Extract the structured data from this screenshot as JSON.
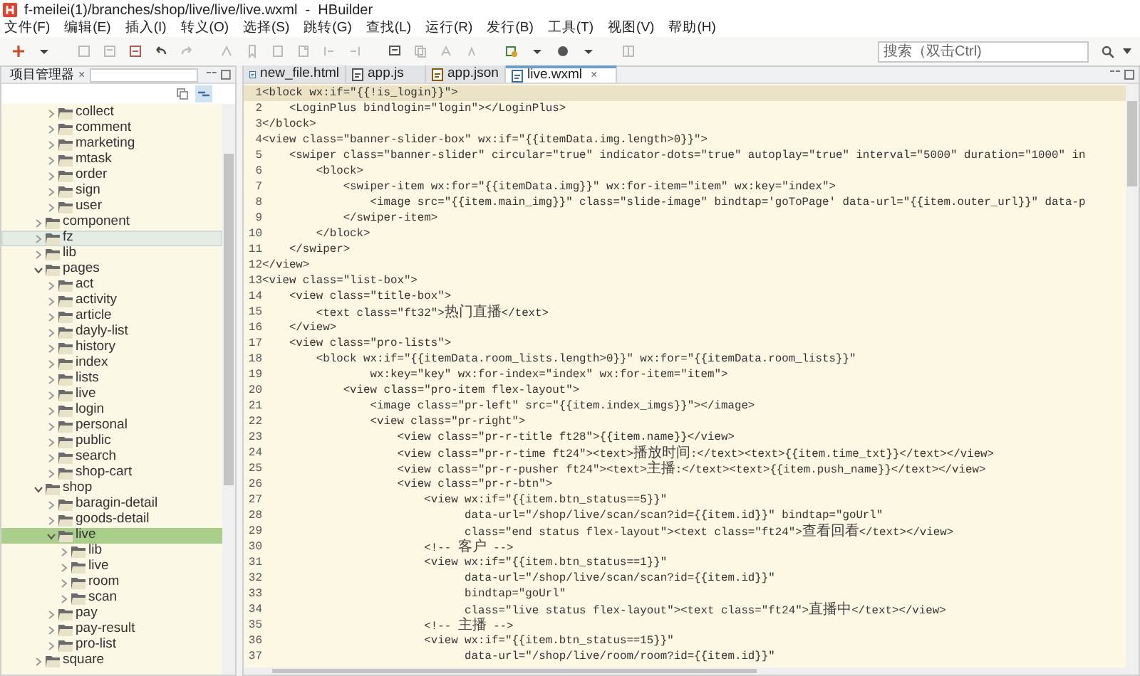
{
  "window": {
    "title": "f-meilei(1)/branches/shop/live/live/live.wxml  -  HBuilder"
  },
  "menu": [
    "文件(F)",
    "编辑(E)",
    "插入(I)",
    "转义(O)",
    "选择(S)",
    "跳转(G)",
    "查找(L)",
    "运行(R)",
    "发行(B)",
    "工具(T)",
    "视图(V)",
    "帮助(H)"
  ],
  "search": {
    "placeholder": "搜索（双击Ctrl)"
  },
  "project_panel": {
    "title": "项目管理器",
    "close": "×",
    "tree": [
      {
        "children": [
          {
            "label": "collect",
            "expanded": false,
            "selected": false,
            "hovered": false
          },
          {
            "label": "comment",
            "expanded": false,
            "selected": false,
            "hovered": false
          },
          {
            "label": "marketing",
            "expanded": false,
            "selected": false,
            "hovered": false
          },
          {
            "label": "mtask",
            "expanded": false,
            "selected": false,
            "hovered": false
          },
          {
            "label": "order",
            "expanded": false,
            "selected": false,
            "hovered": false
          },
          {
            "label": "sign",
            "expanded": false,
            "selected": false,
            "hovered": false
          },
          {
            "label": "user",
            "expanded": false,
            "selected": false,
            "hovered": false
          }
        ]
      },
      {
        "label": "component",
        "expanded": false,
        "selected": false,
        "hovered": false
      },
      {
        "label": "fz",
        "expanded": false,
        "selected": false,
        "hovered": true
      },
      {
        "label": "lib",
        "expanded": false,
        "selected": false,
        "hovered": false
      },
      {
        "label": "pages",
        "expanded": true,
        "selected": false,
        "hovered": false,
        "children": [
          {
            "label": "act",
            "expanded": false,
            "selected": false,
            "hovered": false
          },
          {
            "label": "activity",
            "expanded": false,
            "selected": false,
            "hovered": false
          },
          {
            "label": "article",
            "expanded": false,
            "selected": false,
            "hovered": false
          },
          {
            "label": "dayly-list",
            "expanded": false,
            "selected": false,
            "hovered": false
          },
          {
            "label": "history",
            "expanded": false,
            "selected": false,
            "hovered": false
          },
          {
            "label": "index",
            "expanded": false,
            "selected": false,
            "hovered": false
          },
          {
            "label": "lists",
            "expanded": false,
            "selected": false,
            "hovered": false
          },
          {
            "label": "live",
            "expanded": false,
            "selected": false,
            "hovered": false
          },
          {
            "label": "login",
            "expanded": false,
            "selected": false,
            "hovered": false
          },
          {
            "label": "personal",
            "expanded": false,
            "selected": false,
            "hovered": false
          },
          {
            "label": "public",
            "expanded": false,
            "selected": false,
            "hovered": false
          },
          {
            "label": "search",
            "expanded": false,
            "selected": false,
            "hovered": false
          },
          {
            "label": "shop-cart",
            "expanded": false,
            "selected": false,
            "hovered": false
          }
        ]
      },
      {
        "label": "shop",
        "expanded": true,
        "selected": false,
        "hovered": false,
        "children": [
          {
            "label": "baragin-detail",
            "expanded": false,
            "selected": false,
            "hovered": false
          },
          {
            "label": "goods-detail",
            "expanded": false,
            "selected": false,
            "hovered": false
          },
          {
            "label": "live",
            "expanded": true,
            "selected": true,
            "hovered": false,
            "children": [
              {
                "label": "lib",
                "expanded": false,
                "selected": false,
                "hovered": false
              },
              {
                "label": "live",
                "expanded": false,
                "selected": false,
                "hovered": false
              },
              {
                "label": "room",
                "expanded": false,
                "selected": false,
                "hovered": false
              },
              {
                "label": "scan",
                "expanded": false,
                "selected": false,
                "hovered": false
              }
            ]
          },
          {
            "label": "pay",
            "expanded": false,
            "selected": false,
            "hovered": false
          },
          {
            "label": "pay-result",
            "expanded": false,
            "selected": false,
            "hovered": false
          },
          {
            "label": "pro-list",
            "expanded": false,
            "selected": false,
            "hovered": false
          }
        ]
      },
      {
        "label": "square",
        "expanded": false,
        "selected": false,
        "hovered": false
      }
    ]
  },
  "tabs": [
    {
      "label": "new_file.html",
      "kind": "html",
      "selected": false
    },
    {
      "label": "app.js",
      "kind": "js",
      "selected": false
    },
    {
      "label": "app.json",
      "kind": "json",
      "selected": false
    },
    {
      "label": "live.wxml",
      "kind": "wxml",
      "selected": true,
      "close": "×"
    }
  ],
  "editor": {
    "lines": [
      {
        "number": "1",
        "text": "<block wx:if=\"{{!is_login}}\">",
        "current": true
      },
      {
        "number": "2",
        "text": "    <LoginPlus bindlogin=\"login\"></LoginPlus>",
        "current": false
      },
      {
        "number": "3",
        "text": "</block>",
        "current": false
      },
      {
        "number": "4",
        "text": "<view class=\"banner-slider-box\" wx:if=\"{{itemData.img.length>0}}\">",
        "current": false
      },
      {
        "number": "5",
        "text": "    <swiper class=\"banner-slider\" circular=\"true\" indicator-dots=\"true\" autoplay=\"true\" interval=\"5000\" duration=\"1000\" in",
        "current": false
      },
      {
        "number": "6",
        "text": "        <block>",
        "current": false
      },
      {
        "number": "7",
        "text": "            <swiper-item wx:for=\"{{itemData.img}}\" wx:for-item=\"item\" wx:key=\"index\">",
        "current": false
      },
      {
        "number": "8",
        "text": "                <image src=\"{{item.main_img}}\" class=\"slide-image\" bindtap='goToPage' data-url=\"{{item.outer_url}}\" data-p",
        "current": false
      },
      {
        "number": "9",
        "text": "            </swiper-item>",
        "current": false
      },
      {
        "number": "10",
        "text": "        </block>",
        "current": false
      },
      {
        "number": "11",
        "text": "    </swiper>",
        "current": false
      },
      {
        "number": "12",
        "text": "</view>",
        "current": false
      },
      {
        "number": "13",
        "text": "<view class=\"list-box\">",
        "current": false
      },
      {
        "number": "14",
        "text": "    <view class=\"title-box\">",
        "current": false
      },
      {
        "number": "15",
        "text": "        <text class=\"ft32\">热门直播</text>",
        "current": false
      },
      {
        "number": "16",
        "text": "    </view>",
        "current": false
      },
      {
        "number": "17",
        "text": "    <view class=\"pro-lists\">",
        "current": false
      },
      {
        "number": "18",
        "text": "        <block wx:if=\"{{itemData.room_lists.length>0}}\" wx:for=\"{{itemData.room_lists}}\"",
        "current": false
      },
      {
        "number": "19",
        "text": "                wx:key=\"key\" wx:for-index=\"index\" wx:for-item=\"item\">",
        "current": false
      },
      {
        "number": "20",
        "text": "            <view class=\"pro-item flex-layout\">",
        "current": false
      },
      {
        "number": "21",
        "text": "                <image class=\"pr-left\" src=\"{{item.index_imgs}}\"></image>",
        "current": false
      },
      {
        "number": "22",
        "text": "                <view class=\"pr-right\">",
        "current": false
      },
      {
        "number": "23",
        "text": "                    <view class=\"pr-r-title ft28\">{{item.name}}</view>",
        "current": false
      },
      {
        "number": "24",
        "text": "                    <view class=\"pr-r-time ft24\"><text>播放时间:</text><text>{{item.time_txt}}</text></view>",
        "current": false
      },
      {
        "number": "25",
        "text": "                    <view class=\"pr-r-pusher ft24\"><text>主播:</text><text>{{item.push_name}}</text></view>",
        "current": false
      },
      {
        "number": "26",
        "text": "                    <view class=\"pr-r-btn\">",
        "current": false
      },
      {
        "number": "27",
        "text": "                        <view wx:if=\"{{item.btn_status==5}}\"",
        "current": false
      },
      {
        "number": "28",
        "text": "                              data-url=\"/shop/live/scan/scan?id={{item.id}}\" bindtap=\"goUrl\"",
        "current": false
      },
      {
        "number": "29",
        "text": "                              class=\"end status flex-layout\"><text class=\"ft24\">查看回看</text></view>",
        "current": false
      },
      {
        "number": "30",
        "text": "                        <!-- 客户 -->",
        "current": false
      },
      {
        "number": "31",
        "text": "                        <view wx:if=\"{{item.btn_status==1}}\"",
        "current": false
      },
      {
        "number": "32",
        "text": "                              data-url=\"/shop/live/scan/scan?id={{item.id}}\"",
        "current": false
      },
      {
        "number": "33",
        "text": "                              bindtap=\"goUrl\"",
        "current": false
      },
      {
        "number": "34",
        "text": "                              class=\"live status flex-layout\"><text class=\"ft24\">直播中</text></view>",
        "current": false
      },
      {
        "number": "35",
        "text": "                        <!-- 主播 -->",
        "current": false
      },
      {
        "number": "36",
        "text": "                        <view wx:if=\"{{item.btn_status==15}}\"",
        "current": false
      },
      {
        "number": "37",
        "text": "                              data-url=\"/shop/live/room/room?id={{item.id}}\"",
        "current": false
      }
    ]
  }
}
